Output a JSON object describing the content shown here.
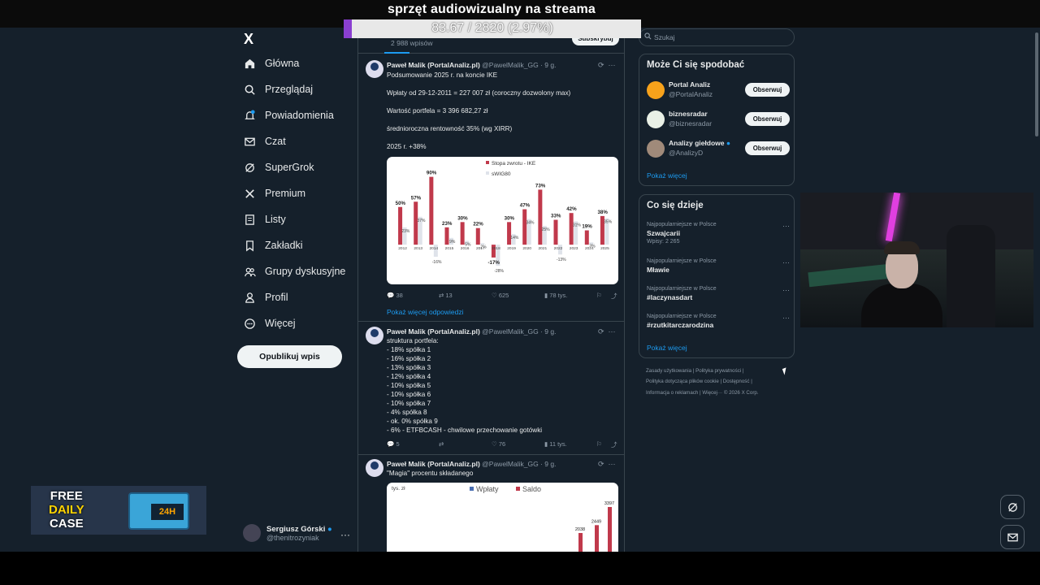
{
  "overlay": {
    "title": "sprzęt audiowizualny na streama",
    "progress_text": "83.67 / 2820 (2.97%)",
    "progress_fraction": 0.0297
  },
  "nav": {
    "logo": "X",
    "items": [
      {
        "label": "Główna",
        "icon": "home-icon"
      },
      {
        "label": "Przeglądaj",
        "icon": "search-icon"
      },
      {
        "label": "Powiadomienia",
        "icon": "bell-icon"
      },
      {
        "label": "Czat",
        "icon": "mail-icon"
      },
      {
        "label": "SuperGrok",
        "icon": "grok-icon"
      },
      {
        "label": "Premium",
        "icon": "x-icon"
      },
      {
        "label": "Listy",
        "icon": "list-icon"
      },
      {
        "label": "Zakładki",
        "icon": "bookmark-icon"
      },
      {
        "label": "Grupy dyskusyjne",
        "icon": "people-icon"
      },
      {
        "label": "Profil",
        "icon": "person-icon"
      },
      {
        "label": "Więcej",
        "icon": "more-circle-icon"
      }
    ],
    "post_button": "Opublikuj wpis",
    "user": {
      "name": "Sergiusz Górski",
      "handle": "@thenitrozyniak",
      "more": "···"
    }
  },
  "ad": {
    "line1": "FREE",
    "line2": "DAILY",
    "line3": "CASE",
    "badge": "24H"
  },
  "feed": {
    "post_count": "2 988 wpisów",
    "header_button": "Subskrybuj",
    "tweets": [
      {
        "name": "Paweł Malik (PortalAnaliz.pl)",
        "handle": "@PawelMalik_GG · 9 g.",
        "body": "Podsumowanie 2025 r. na koncie IKE\n\nWpłaty od 29-12-2011 = 227 007 zł (coroczny dozwolony max)\n\nWartość portfela = 3 396 682,27 zł\n\nśrednioroczna rentowność 35% (wg XIRR)\n\n2025 r. +38%",
        "replies": "38",
        "reposts": "13",
        "likes": "625",
        "views": "78 tys."
      },
      {
        "name": "Paweł Malik (PortalAnaliz.pl)",
        "handle": "@PawelMalik_GG · 9 g.",
        "body": "struktura portfela:\n- 18% spółka 1\n- 16% spółka 2\n- 13% spółka 3\n- 12% spółka 4\n- 10% spółka 5\n- 10% spółka 6\n- 10% spółka 7\n- 4% spółka 8\n- ok. 0% spółka 9\n- 6% - ETFBCASH - chwilowe przechowanie gotówki",
        "replies": "5",
        "reposts": "",
        "likes": "76",
        "views": "11 tys."
      },
      {
        "name": "Paweł Malik (PortalAnaliz.pl)",
        "handle": "@PawelMalik_GG · 9 g.",
        "body": "\"Magia\" procentu składanego"
      }
    ],
    "show_more_replies": "Pokaż więcej odpowiedzi"
  },
  "chart_data": [
    {
      "type": "bar",
      "categories": [
        "2012",
        "2013",
        "2014",
        "2015",
        "2016",
        "2017",
        "2018",
        "2019",
        "2020",
        "2021",
        "2022",
        "2023",
        "2024",
        "2025"
      ],
      "series": [
        {
          "name": "Stopa zwrotu - IKE",
          "color": "#c0394b",
          "values": [
            50,
            57,
            90,
            23,
            30,
            22,
            -17,
            30,
            47,
            73,
            33,
            42,
            19,
            38
          ]
        },
        {
          "name": "sWIG80",
          "color": "#dfe3ea",
          "values": [
            23,
            37,
            -16,
            9,
            5,
            2,
            -28,
            14,
            34,
            25,
            -13,
            31,
            3,
            35
          ]
        }
      ],
      "labels_series1": [
        "50%",
        "57%",
        "90%",
        "23%",
        "30%",
        "22%",
        "-17%",
        "30%",
        "47%",
        "73%",
        "33%",
        "42%",
        "19%",
        "38%"
      ],
      "labels_series2": [
        "23%",
        "37%",
        "-16%",
        "9%",
        "5%",
        "2%",
        "-28%",
        "14%",
        "34%",
        "25%",
        "-13%",
        "31%",
        "3%",
        "35%"
      ],
      "ylim": [
        -30,
        95
      ],
      "legend": "top-center"
    },
    {
      "type": "bar",
      "legend_items": [
        {
          "name": "Wpłaty",
          "color": "#4a6fb3"
        },
        {
          "name": "Saldo",
          "color": "#c0394b"
        }
      ],
      "ylabel": "tys. zł",
      "visible_labels": [
        "3397",
        "2449",
        "2038"
      ],
      "values": [
        2038,
        2449,
        3397
      ]
    }
  ],
  "right": {
    "search_placeholder": "Szukaj",
    "wtf_title": "Może Ci się spodobać",
    "wtf": [
      {
        "name": "Portal Analiz",
        "handle": "@PortalAnaliz",
        "color": "#f7a21b",
        "verified": false
      },
      {
        "name": "biznesradar",
        "handle": "@biznesradar",
        "color": "#e9f0e6",
        "verified": false
      },
      {
        "name": "Analizy giełdowe",
        "handle": "@AnalizyD",
        "color": "#a08a7a",
        "verified": true
      }
    ],
    "follow_label": "Obserwuj",
    "show_more": "Pokaż więcej",
    "trends_title": "Co się dzieje",
    "trends": [
      {
        "category": "Najpopularniejsze w Polsce",
        "name": "Szwajcarii",
        "posts": "Wpisy: 2 265"
      },
      {
        "category": "Najpopularniejsze w Polsce",
        "name": "Mławie",
        "posts": ""
      },
      {
        "category": "Najpopularniejsze w Polsce",
        "name": "#laczynasdart",
        "posts": ""
      },
      {
        "category": "Najpopularniejsze w Polsce",
        "name": "#rzutkitarczarodzina",
        "posts": ""
      }
    ],
    "footer": {
      "line1": "Zasady użytkowania  |  Polityka prywatności  |",
      "line2": "Polityka dotycząca plików cookie  |  Dostępność  |",
      "line3": "Informacja o reklamach  |  Więcej···  © 2026 X Corp."
    }
  }
}
